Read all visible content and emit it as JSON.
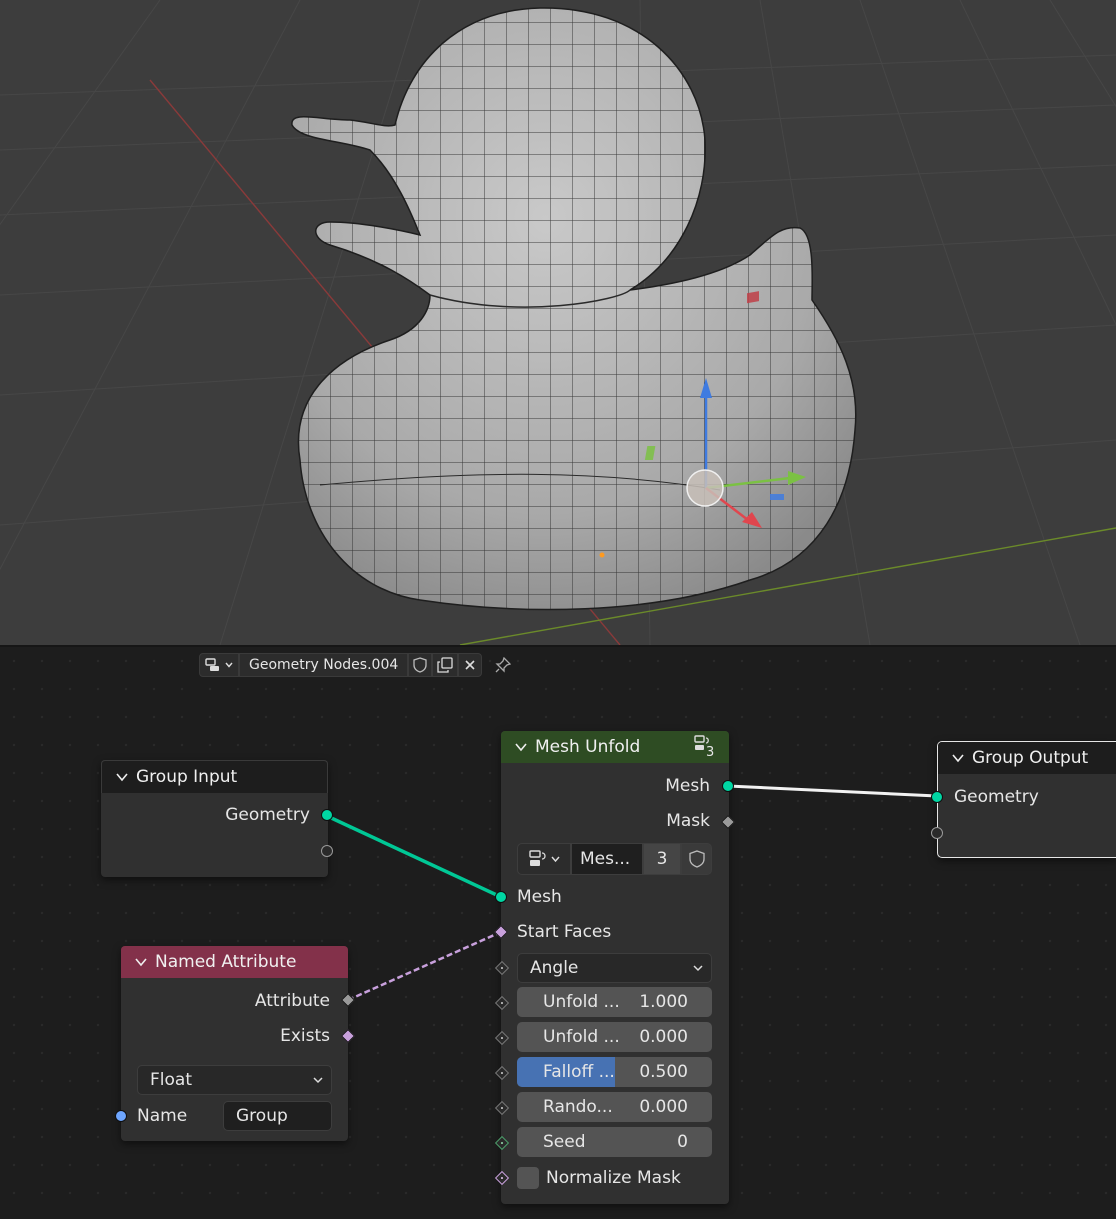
{
  "viewport": {
    "object": "rubber-duck-mesh",
    "gizmo_icons": [
      "move-gizmo-icon"
    ]
  },
  "header": {
    "node_group_name": "Geometry Nodes.004",
    "icons": [
      "node-tree-browse-icon",
      "fake-user-shield-icon",
      "duplicate-icon",
      "unlink-x-icon",
      "pin-icon"
    ]
  },
  "colors": {
    "geometry_socket": "#00d6a3",
    "field_socket_pink": "#c8a0dc",
    "group_header": "#1d1d1d",
    "geometry_header": "#2e4c23",
    "attribute_header": "#83314a",
    "slider_fill": "#4772b3"
  },
  "nodes": {
    "group_input": {
      "title": "Group Input",
      "outputs": [
        "Geometry"
      ]
    },
    "named_attribute": {
      "title": "Named Attribute",
      "outputs": [
        "Attribute",
        "Exists"
      ],
      "data_type": "Float",
      "name_label": "Name",
      "name_value": "Group"
    },
    "mesh_unfold": {
      "title": "Mesh Unfold",
      "user_count": "3",
      "outputs": [
        "Mesh",
        "Mask"
      ],
      "group_selector": {
        "name": "Mes...",
        "users": "3"
      },
      "inputs": {
        "mesh": "Mesh",
        "start_faces": "Start Faces",
        "mode": "Angle",
        "params": [
          {
            "label": "Unfold ...",
            "value": "1.000"
          },
          {
            "label": "Unfold ...",
            "value": "0.000"
          },
          {
            "label": "Falloff ...",
            "value": "0.500",
            "fill": 0.5
          },
          {
            "label": "Rando...",
            "value": "0.000"
          },
          {
            "label": "Seed",
            "value": "0"
          }
        ],
        "normalize_mask": "Normalize Mask"
      }
    },
    "group_output": {
      "title": "Group Output",
      "inputs": [
        "Geometry"
      ]
    }
  }
}
